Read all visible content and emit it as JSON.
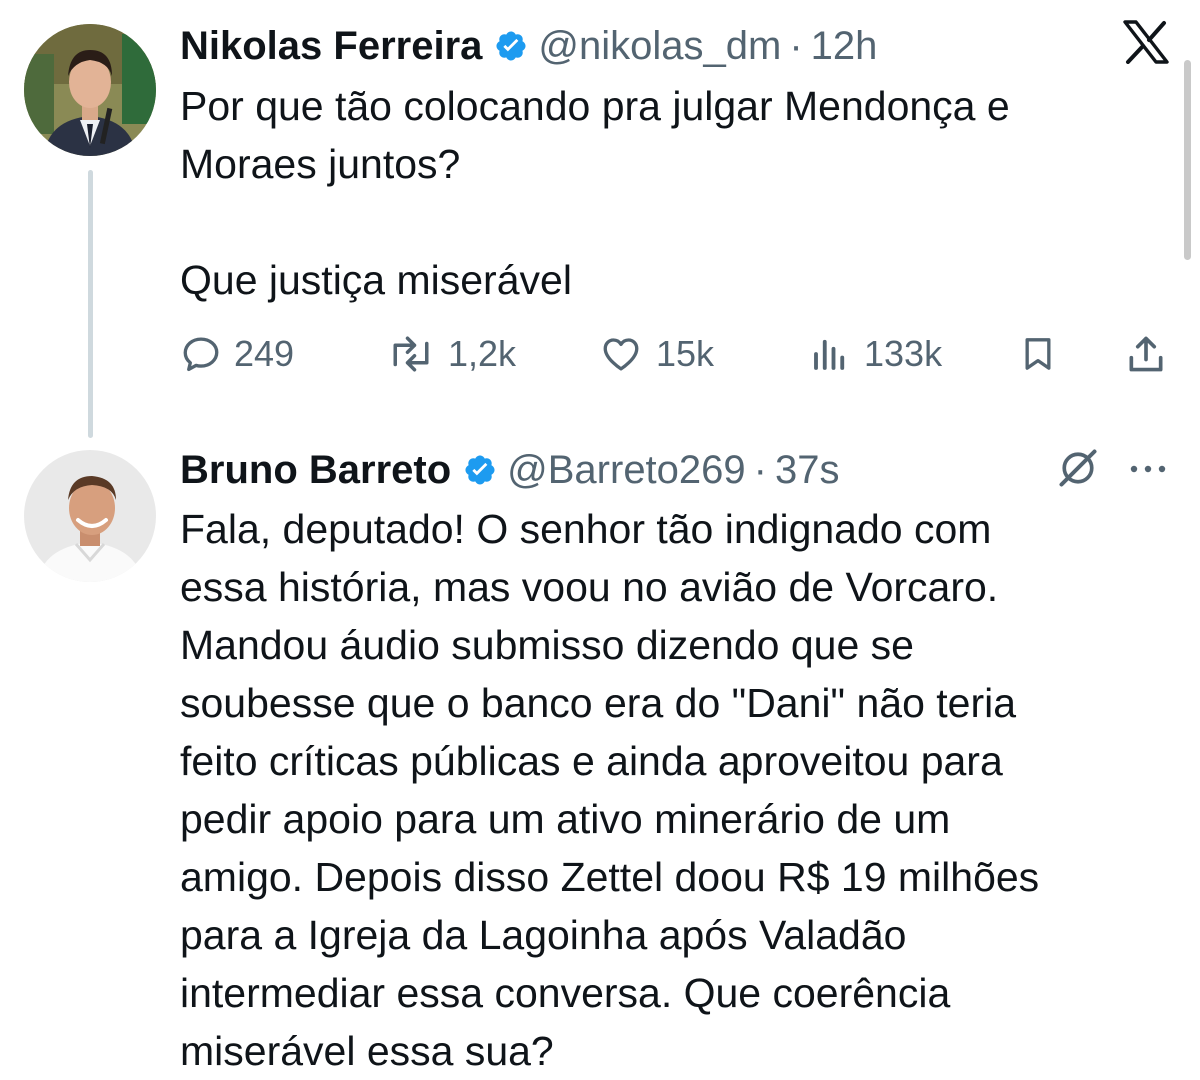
{
  "platform": {
    "icon": "x-logo-icon"
  },
  "tweets": [
    {
      "author_name": "Nikolas Ferreira",
      "handle": "@nikolas_dm",
      "separator": "·",
      "time": "12h",
      "verified": true,
      "text": "Por que tão colocando pra julgar Mendonça e\nMoraes juntos?\n\nQue justiça miserável",
      "stats": {
        "replies": "249",
        "reposts": "1,2k",
        "likes": "15k",
        "views": "133k"
      }
    },
    {
      "author_name": "Bruno Barreto",
      "handle": "@Barreto269",
      "separator": "·",
      "time": "37s",
      "verified": true,
      "text": "Fala, deputado! O senhor tão indignado com\nessa história, mas voou no avião de Vorcaro.\nMandou áudio submisso dizendo que se\nsoubesse que o banco era do \"Dani\" não teria\nfeito críticas públicas e ainda aproveitou para\npedir apoio para um ativo minerário de um\namigo. Depois disso Zettel doou R$ 19 milhões\npara a Igreja da Lagoinha após Valadão\nintermediar essa conversa. Que coerência\nmiserável essa sua?"
    }
  ],
  "colors": {
    "verified": "#1d9bf0",
    "text": "#0f1419",
    "muted": "#536471",
    "thread_line": "#cfd9de"
  }
}
